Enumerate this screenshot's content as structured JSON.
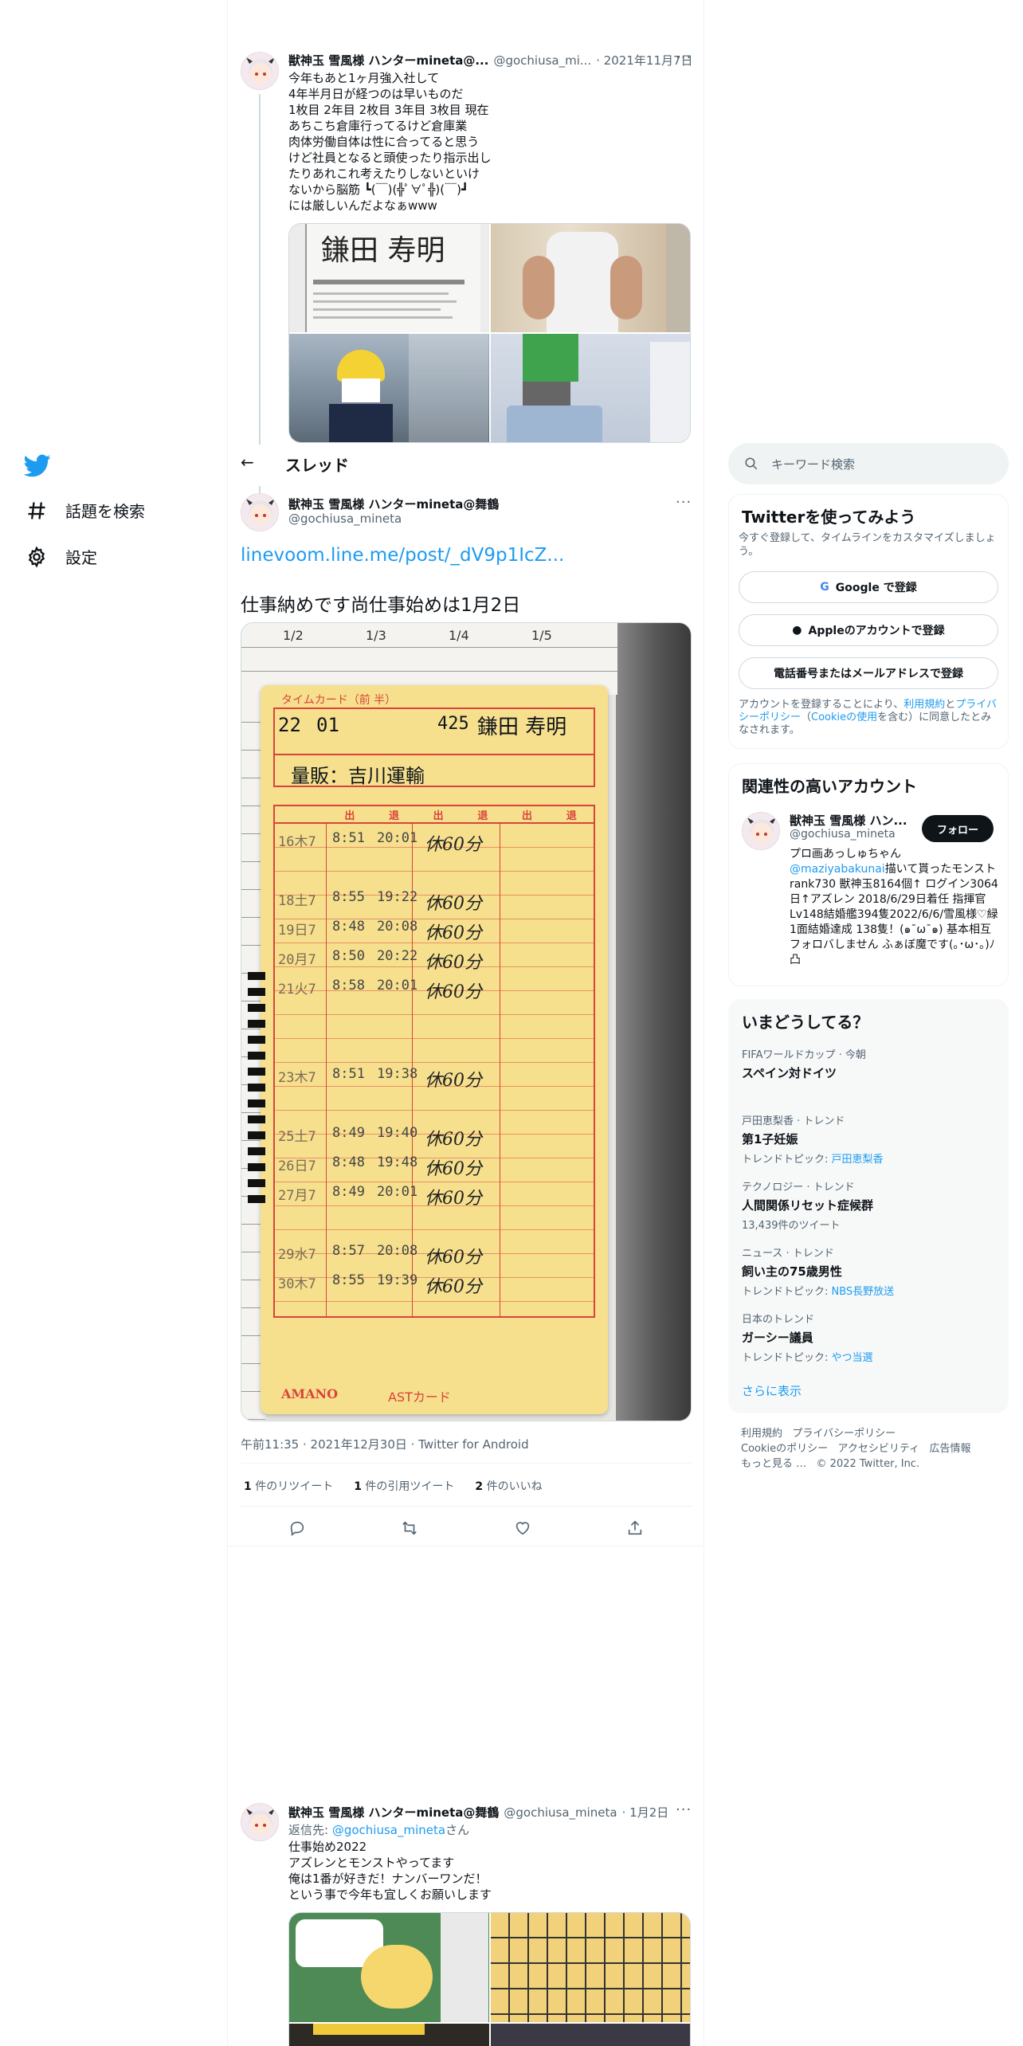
{
  "nav": {
    "explore_label": "話題を検索",
    "settings_label": "設定"
  },
  "tweet_top": {
    "author_name": "獣神玉 雪風様 ハンターmineta@...",
    "handle": "@gochiusa_mi...",
    "date": "· 2021年11月7日",
    "text": "今年もあと1ヶ月強入社して\n4年半月日が経つのは早いものだ\n1枚目 2年目 2枚目 3年目 3枚目 現在\nあちこち倉庫行ってるけど倉庫業\n肉体労働自体は性に合ってると思う\nけど社員となると頭使ったり指示出し\nたりあれこれ考えたりしないといけ\nないから脳筋 ┗(￣)(╬ﾟ∀ﾟ╬)(￣)┛\nには厳しいんだよなぁwww",
    "photo1_name": "鎌田 寿明"
  },
  "header": {
    "back_label": "←",
    "title": "スレッド"
  },
  "main_tweet": {
    "author_name": "獣神玉 雪風様 ハンターmineta@舞鶴",
    "handle": "@gochiusa_mineta",
    "link_text": "linevoom.line.me/post/_dV9p1IcZ...",
    "text": "仕事納めです尚仕事始めは1月2日",
    "meta": "午前11:35 · 2021年12月30日 · Twitter for Android",
    "stats": {
      "retweets_count": "1",
      "retweets_label": "件のリツイート",
      "quotes_count": "1",
      "quotes_label": "件の引用ツイート",
      "likes_count": "2",
      "likes_label": "件のいいね"
    },
    "card": {
      "dates": [
        "1/2",
        "1/3",
        "1/4",
        "1/5"
      ],
      "header_label": "タイムカード（前 半）",
      "year": "22",
      "month": "01",
      "number": "425",
      "name": "鎌田 寿明",
      "company": "量販：吉川運輸",
      "columns": [
        "出",
        "退",
        "出",
        "退",
        "出",
        "退"
      ],
      "rows": [
        {
          "day": "16木7",
          "in": "8:51",
          "out": "20:01",
          "note": "休60分"
        },
        {
          "day": "18土7",
          "in": "8:55",
          "out": "19:22",
          "note": "休60分"
        },
        {
          "day": "19日7",
          "in": "8:48",
          "out": "20:08",
          "note": "休60分"
        },
        {
          "day": "20月7",
          "in": "8:50",
          "out": "20:22",
          "note": "休60分"
        },
        {
          "day": "21火7",
          "in": "8:58",
          "out": "20:01",
          "note": "休60分"
        },
        {
          "day": "23木7",
          "in": "8:51",
          "out": "19:38",
          "note": "休60分"
        },
        {
          "day": "25土7",
          "in": "8:49",
          "out": "19:40",
          "note": "休60分"
        },
        {
          "day": "26日7",
          "in": "8:48",
          "out": "19:48",
          "note": "休60分"
        },
        {
          "day": "27月7",
          "in": "8:49",
          "out": "20:01",
          "note": "休60分"
        },
        {
          "day": "29水7",
          "in": "8:57",
          "out": "20:08",
          "note": "休60分"
        },
        {
          "day": "30木7",
          "in": "8:55",
          "out": "19:39",
          "note": "休60分"
        }
      ],
      "brand_left": "AMANO",
      "brand_right": "ASTカード"
    }
  },
  "reply_tweet": {
    "author_name": "獣神玉 雪風様 ハンターmineta@舞鶴",
    "handle": "@gochiusa_mineta",
    "date": "· 1月2日",
    "reply_prefix": "返信先: ",
    "reply_to": "@gochiusa_mineta",
    "reply_suffix": "さん",
    "text": "仕事始め2022\nアズレンとモンストやってます\n俺は1番が好きだ！ナンバーワンだ！\nという事で今年も宜しくお願いします"
  },
  "search": {
    "placeholder": "キーワード検索"
  },
  "signup": {
    "title": "Twitterを使ってみよう",
    "desc": "今すぐ登録して、タイムラインをカスタマイズしましょう。",
    "google_label": "Google で登録",
    "apple_label": "Appleのアカウントで登録",
    "phone_label": "電話番号またはメールアドレスで登録",
    "terms_prefix": "アカウントを登録することにより、",
    "terms_link": "利用規約",
    "terms_mid": "と",
    "privacy_link": "プライバシーポリシー",
    "cookie_open": "（",
    "cookie_link": "Cookieの使用",
    "terms_suffix": "を含む）に同意したとみなされます。"
  },
  "related": {
    "title": "関連性の高いアカウント",
    "name": "獣神玉 雪風様 ハン...",
    "handle": "@gochiusa_mineta",
    "follow_label": "フォロー",
    "bio_prefix": "プロ画あっしゅちゃん",
    "bio_mention": "@maziyabakunai",
    "bio_rest": "描いて貰ったモンスト rank730 獣神玉8164個↑ ログイン3064日↑アズレン 2018/6/29日着任 指揮官Lv148結婚艦394隻2022/6/6/雪風様♡緑1面結婚達成 138隻！(๑¯ω¯๑) 基本相互フォロバしません ふぁぼ魔です(｡･ω･｡)ﾉ 凸"
  },
  "trends": {
    "title": "いまどうしてる？",
    "items": [
      {
        "meta": "FIFAワールドカップ · 今朝",
        "name": "スペイン対ドイツ",
        "sub_label": "",
        "sub_link": ""
      },
      {
        "meta": "戸田恵梨香 · トレンド",
        "name": "第1子妊娠",
        "sub_label": "トレンドトピック: ",
        "sub_link": "戸田恵梨香"
      },
      {
        "meta": "テクノロジー · トレンド",
        "name": "人間関係リセット症候群",
        "sub_label": "13,439件のツイート",
        "sub_link": ""
      },
      {
        "meta": "ニュース · トレンド",
        "name": "飼い主の75歳男性",
        "sub_label": "トレンドトピック: ",
        "sub_link": "NBS長野放送"
      },
      {
        "meta": "日本のトレンド",
        "name": "ガーシー議員",
        "sub_label": "トレンドトピック: ",
        "sub_link": "やつ当選"
      }
    ],
    "more_label": "さらに表示"
  },
  "footer": {
    "terms": "利用規約",
    "privacy": "プライバシーポリシー",
    "cookie": "Cookieのポリシー",
    "accessibility": "アクセシビリティ",
    "ads": "広告情報",
    "more": "もっと見る …",
    "copyright": "© 2022 Twitter, Inc."
  },
  "colors": {
    "brand": "#1d9bf0",
    "text": "#0f1419",
    "muted": "#536471",
    "border": "#eff3f4",
    "card_yellow": "#f6e08e",
    "card_red": "#d9443a"
  }
}
